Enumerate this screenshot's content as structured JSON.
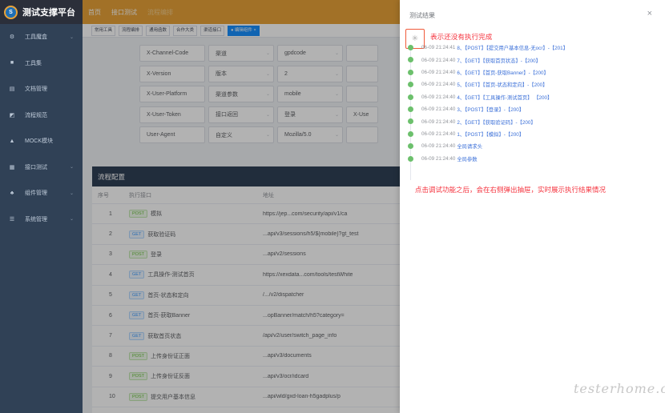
{
  "app": {
    "title": "测试支撑平台",
    "logo_text": "S"
  },
  "header": {
    "nav": [
      "首页",
      "接口测试"
    ],
    "extra": "流程编排"
  },
  "sidebar": {
    "items": [
      {
        "label": "工具魔盒",
        "icon": "gear-icon"
      },
      {
        "label": "工具集",
        "icon": "wrench-icon"
      },
      {
        "label": "文档管理",
        "icon": "document-icon"
      },
      {
        "label": "流程规范",
        "icon": "flow-icon"
      },
      {
        "label": "MOCK模块",
        "icon": "mock-icon"
      },
      {
        "label": "接口测试",
        "icon": "api-icon"
      },
      {
        "label": "组件管理",
        "icon": "component-icon"
      },
      {
        "label": "系统管理",
        "icon": "system-icon"
      }
    ]
  },
  "tags": [
    "常用工具",
    "流程编排",
    "通用函数",
    "合作大类",
    "渠道接口",
    "● 编辑组件 ×"
  ],
  "header_params": [
    [
      "X-Channel-Code",
      "渠道",
      "gpdcode",
      ""
    ],
    [
      "X-Version",
      "版本",
      "2",
      ""
    ],
    [
      "X-User-Platform",
      "渠道参数",
      "mobile",
      ""
    ],
    [
      "X-User-Token",
      "接口返回",
      "登录",
      "X-Use"
    ],
    [
      "User-Agent",
      "自定义",
      "Mozilla/5.0",
      ""
    ]
  ],
  "flow": {
    "title": "流程配置",
    "columns": [
      "序号",
      "执行接口",
      "地址"
    ],
    "rows": [
      {
        "idx": "1",
        "method": "POST",
        "name": "模拟",
        "addr": "https://jep...com/security/api/v1/ca"
      },
      {
        "idx": "2",
        "method": "GET",
        "name": "获取验证码",
        "addr": "...api/v3/sessions/h5/${mobile}?gt_test"
      },
      {
        "idx": "3",
        "method": "POST",
        "name": "登录",
        "addr": "...api/v2/sessions"
      },
      {
        "idx": "4",
        "method": "GET",
        "name": "工具操作-测试首页",
        "addr": "https://xexdata...com/tools/testWhite"
      },
      {
        "idx": "5",
        "method": "GET",
        "name": "首页-状态和定向",
        "addr": "/.../v2/dispatcher"
      },
      {
        "idx": "6",
        "method": "GET",
        "name": "首页-获取Banner",
        "addr": "...opBanner/match/h5?category="
      },
      {
        "idx": "7",
        "method": "GET",
        "name": "获取首页状态",
        "addr": "/api/v2/user/switch_page_info"
      },
      {
        "idx": "8",
        "method": "POST",
        "name": "上传身份证正面",
        "addr": "...api/v3/documents"
      },
      {
        "idx": "9",
        "method": "POST",
        "name": "上传身份证反面",
        "addr": "...api/v3/ocr/idcard"
      },
      {
        "idx": "10",
        "method": "POST",
        "name": "提交用户基本信息",
        "addr": "...api/wld/gxd-loan-h5gadplus/p"
      }
    ]
  },
  "drawer": {
    "title": "测试结果",
    "close": "×",
    "annotation_top": "表示还没有执行完成",
    "annotation_mid": "点击调试功能之后，会在右侧弹出抽屉，实时展示执行结果情况",
    "timeline": [
      {
        "time": "06-09 21:24:41",
        "text": "8、【POST】【提交用户基本信息-无ocr】-【201】"
      },
      {
        "time": "06-09 21:24:40",
        "text": "7、【GET】【获取首页状态】-【200】"
      },
      {
        "time": "06-09 21:24:40",
        "text": "6、【GET】【首页-获取Banner】-【200】"
      },
      {
        "time": "06-09 21:24:40",
        "text": "5、【GET】【首页-状态和定向】-【200】"
      },
      {
        "time": "06-09 21:24:40",
        "text": "4、【GET】【工具操作-测试首页】                      【200】"
      },
      {
        "time": "06-09 21:24:40",
        "text": "3、【POST】【登录】-【200】"
      },
      {
        "time": "06-09 21:24:40",
        "text": "2、【GET】【获取验证码】-【200】"
      },
      {
        "time": "06-09 21:24:40",
        "text": "1、【POST】【模拟】-【200】"
      },
      {
        "time": "06-09 21:24:40",
        "text": "全局请求头"
      },
      {
        "time": "06-09 21:24:40",
        "text": "全局参数"
      }
    ]
  },
  "watermark": "testerhome.com"
}
